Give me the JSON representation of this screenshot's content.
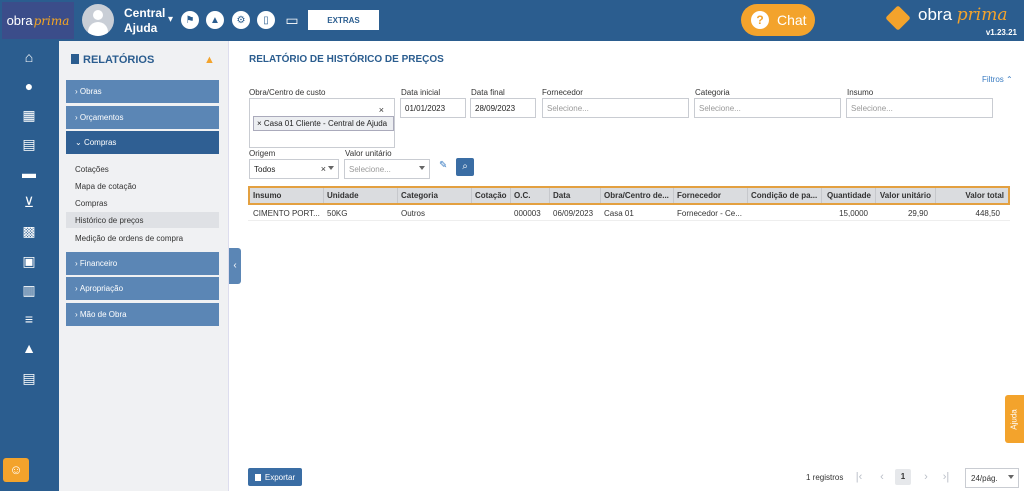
{
  "topbar": {
    "logo": {
      "part1": "obra",
      "part2": "prima"
    },
    "user_name": "Central Ajuda",
    "extras_label": "EXTRAS",
    "chat_label": "Chat",
    "brand": {
      "part1": "obra",
      "part2": "prima",
      "version": "v1.23.21"
    },
    "icons": [
      "flag-icon",
      "graduation-cap-icon",
      "gear-icon",
      "mobile-icon",
      "monitor-icon"
    ]
  },
  "rail": {
    "icons": [
      "home-icon",
      "user-icon",
      "building-icon",
      "invoice-icon",
      "truck-icon",
      "cart-icon",
      "calculator-icon",
      "boxes-icon",
      "document-icon",
      "checklist-icon",
      "chart-icon",
      "file-icon"
    ]
  },
  "sidebar": {
    "title": "RELATÓRIOS",
    "items": [
      {
        "label": "Obras"
      },
      {
        "label": "Orçamentos"
      },
      {
        "label": "Compras"
      },
      {
        "label": "Financeiro"
      },
      {
        "label": "Apropriação"
      },
      {
        "label": "Mão de Obra"
      }
    ],
    "compras_sub": [
      {
        "label": "Cotações"
      },
      {
        "label": "Mapa de cotação"
      },
      {
        "label": "Compras"
      },
      {
        "label": "Histórico de preços"
      },
      {
        "label": "Medição de ordens de compra"
      }
    ]
  },
  "main": {
    "title": "RELATÓRIO DE HISTÓRICO DE PREÇOS",
    "filters_link": "Filtros",
    "filters": {
      "obra_label": "Obra/Centro de custo",
      "obra_tag": "Casa 01 Cliente - Central de Ajuda",
      "data_inicial_label": "Data inicial",
      "data_inicial_value": "01/01/2023",
      "data_final_label": "Data final",
      "data_final_value": "28/09/2023",
      "fornecedor_label": "Fornecedor",
      "categoria_label": "Categoria",
      "insumo_label": "Insumo",
      "placeholder": "Selecione...",
      "origem_label": "Origem",
      "origem_value": "Todos",
      "valor_label": "Valor unitário"
    },
    "table": {
      "headers": [
        "Insumo",
        "Unidade",
        "Categoria",
        "Cotação",
        "O.C.",
        "Data",
        "Obra/Centro de...",
        "Fornecedor",
        "Condição de pa...",
        "Quantidade",
        "Valor unitário",
        "Valor total"
      ],
      "rows": [
        [
          "CIMENTO PORT...",
          "50KG",
          "Outros",
          "",
          "000003",
          "06/09/2023",
          "Casa 01",
          "Fornecedor - Ce...",
          "",
          "15,0000",
          "29,90",
          "448,50"
        ]
      ]
    },
    "footer": {
      "export_label": "Exportar",
      "records": "1 registros",
      "current_page": "1",
      "per_page": "24/pág."
    }
  },
  "ajuda_label": "Ajuda"
}
